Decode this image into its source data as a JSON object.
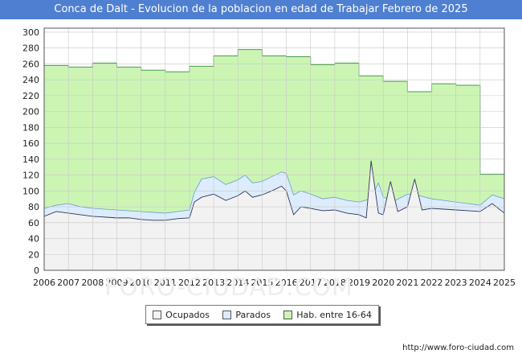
{
  "chart_data": {
    "type": "area",
    "title": "Conca de Dalt - Evolucion de la poblacion en edad de Trabajar Febrero de 2025",
    "xlabel": "",
    "ylabel": "",
    "x_ticks": [
      "2006",
      "2007",
      "2008",
      "2009",
      "2010",
      "2011",
      "2012",
      "2013",
      "2014",
      "2015",
      "2016",
      "2017",
      "2018",
      "2019",
      "2020",
      "2021",
      "2022",
      "2023",
      "2024",
      "2025"
    ],
    "y_ticks": [
      0,
      20,
      40,
      60,
      80,
      100,
      120,
      140,
      160,
      180,
      200,
      220,
      240,
      260,
      280,
      300
    ],
    "ylim": [
      0,
      305
    ],
    "xlim": [
      2006,
      2025
    ],
    "grid": true,
    "legend_position": "bottom",
    "series": [
      {
        "name": "Hab. entre 16-64",
        "color": "#ccf5b4",
        "stroke": "#4a9a4a",
        "annual_values": [
          258,
          256,
          261,
          256,
          252,
          250,
          257,
          270,
          278,
          270,
          269,
          259,
          261,
          245,
          238,
          225,
          235,
          233,
          121
        ]
      },
      {
        "name": "Parados",
        "color": "#dcecfc",
        "stroke": "#6a9ad4",
        "x": [
          2006.0,
          2006.5,
          2007.0,
          2007.5,
          2008.0,
          2008.5,
          2009.0,
          2009.5,
          2010.0,
          2010.5,
          2011.0,
          2011.5,
          2012.0,
          2012.2,
          2012.5,
          2013.0,
          2013.5,
          2014.0,
          2014.3,
          2014.6,
          2015.0,
          2015.4,
          2015.8,
          2016.0,
          2016.3,
          2016.6,
          2017.0,
          2017.5,
          2018.0,
          2018.5,
          2019.0,
          2019.5,
          2019.8,
          2020.0,
          2020.5,
          2021.0,
          2021.5,
          2022.0,
          2022.5,
          2023.0,
          2023.5,
          2024.0,
          2024.5,
          2025.0
        ],
        "values": [
          78,
          82,
          84,
          80,
          78,
          77,
          76,
          75,
          74,
          73,
          72,
          74,
          76,
          98,
          115,
          118,
          108,
          114,
          120,
          110,
          112,
          118,
          124,
          122,
          95,
          100,
          96,
          90,
          92,
          88,
          86,
          90,
          110,
          92,
          88,
          96,
          94,
          90,
          88,
          86,
          84,
          82,
          95,
          90
        ]
      },
      {
        "name": "Ocupados",
        "color": "#f2f2f2",
        "stroke": "#333355",
        "x": [
          2006.0,
          2006.5,
          2007.0,
          2007.5,
          2008.0,
          2008.5,
          2009.0,
          2009.5,
          2010.0,
          2010.5,
          2011.0,
          2011.5,
          2012.0,
          2012.2,
          2012.5,
          2013.0,
          2013.5,
          2014.0,
          2014.3,
          2014.6,
          2015.0,
          2015.4,
          2015.8,
          2016.0,
          2016.3,
          2016.6,
          2017.0,
          2017.5,
          2018.0,
          2018.5,
          2019.0,
          2019.3,
          2019.5,
          2019.8,
          2020.0,
          2020.3,
          2020.6,
          2021.0,
          2021.3,
          2021.6,
          2022.0,
          2022.5,
          2023.0,
          2023.5,
          2024.0,
          2024.5,
          2025.0
        ],
        "values": [
          68,
          74,
          72,
          70,
          68,
          67,
          66,
          66,
          64,
          63,
          63,
          65,
          66,
          86,
          92,
          96,
          88,
          94,
          100,
          92,
          95,
          100,
          106,
          100,
          70,
          80,
          78,
          75,
          76,
          72,
          70,
          66,
          138,
          72,
          70,
          112,
          74,
          80,
          115,
          76,
          78,
          77,
          76,
          75,
          74,
          84,
          72
        ]
      }
    ]
  },
  "legend": {
    "ocupados": "Ocupados",
    "parados": "Parados",
    "hab": "Hab. entre 16-64"
  },
  "footer": {
    "url": "http://www.foro-ciudad.com"
  },
  "watermark": "FORO-CIUDAD.COM"
}
